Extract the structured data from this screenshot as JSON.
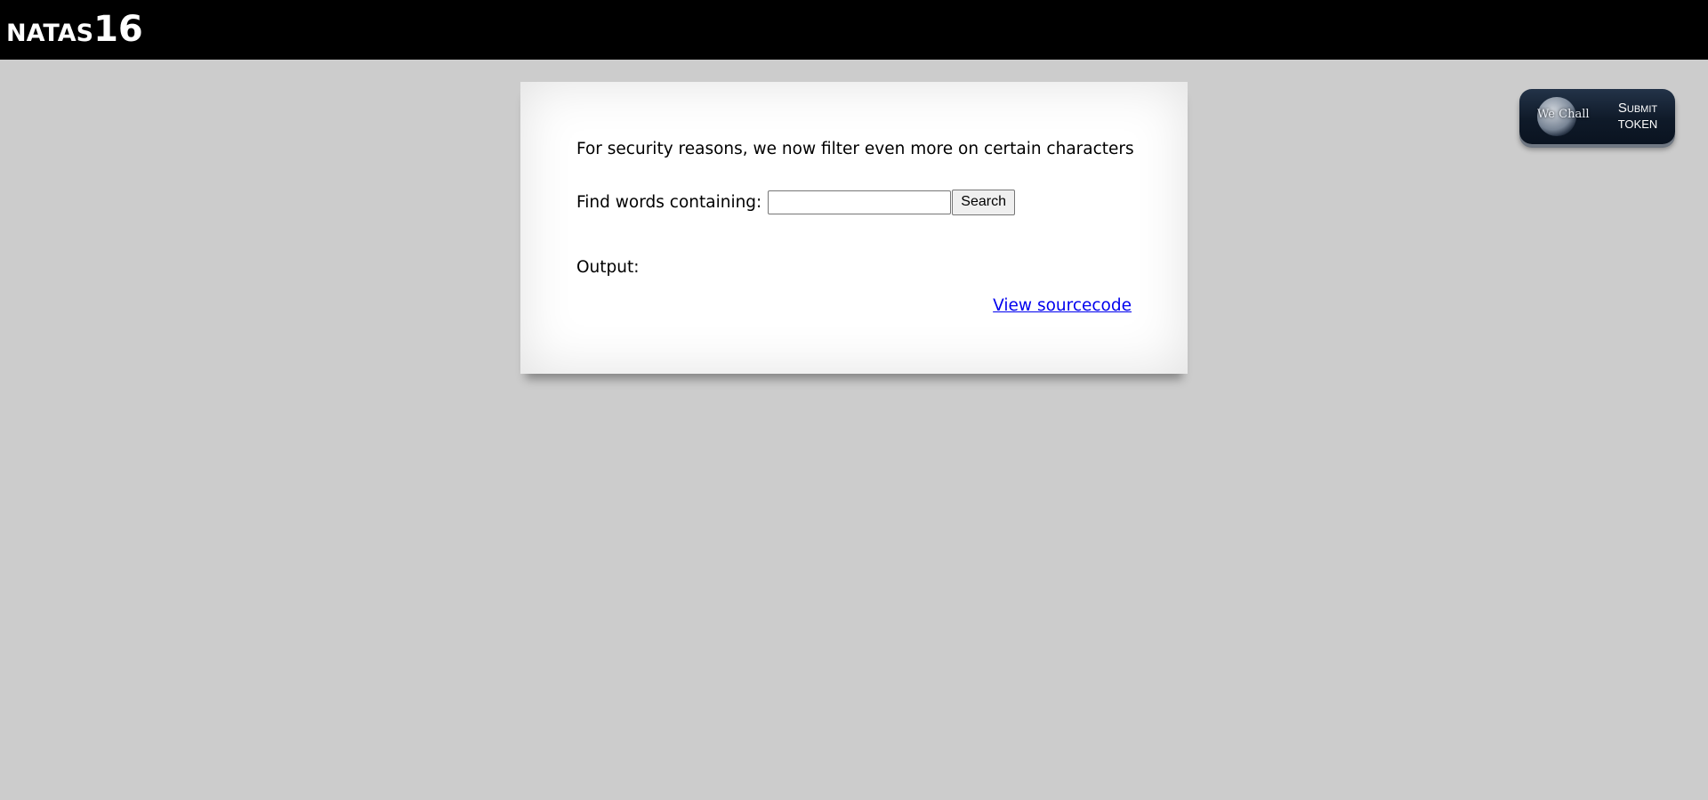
{
  "header": {
    "title_prefix": "NATAS",
    "title_number": "16"
  },
  "wechall_button": {
    "logo_text": "We Chall",
    "line1": "Submit",
    "line2": "TOKEN"
  },
  "content": {
    "intro": "For security reasons, we now filter even more on certain characters",
    "find_label": "Find words containing:",
    "search_value": "",
    "search_button": "Search",
    "output_label": "Output:",
    "source_link": "View sourcecode"
  }
}
